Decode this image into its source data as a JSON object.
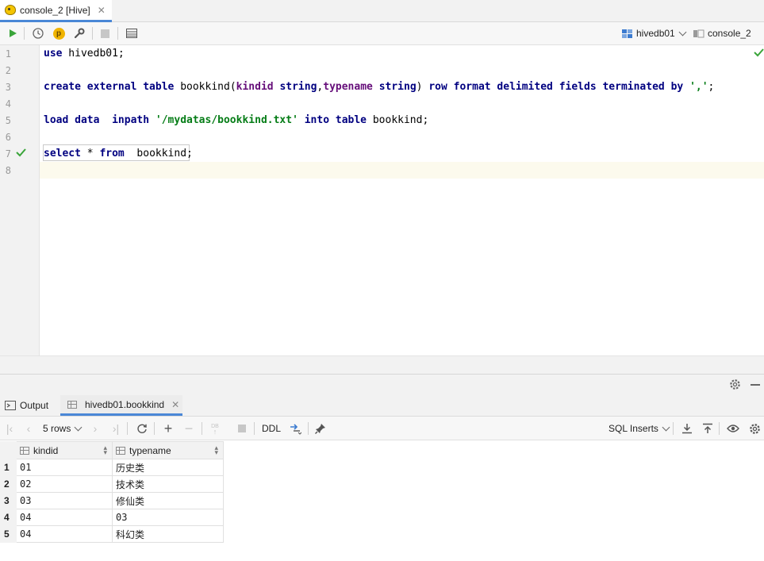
{
  "tab": {
    "title": "console_2 [Hive]",
    "close_icon": "close-icon"
  },
  "toolbar": {
    "datasource": "hivedb01",
    "session": "console_2",
    "p_badge": "p"
  },
  "editor": {
    "line_numbers": [
      "1",
      "2",
      "3",
      "4",
      "5",
      "6",
      "7",
      "8"
    ],
    "lines": {
      "l1": {
        "kw": "use",
        "rest": " hivedb01;"
      },
      "l3": {
        "kw1": "create external table",
        "name": " bookkind(",
        "c1": "kindid",
        "t1": " string",
        "comma": ",",
        "c2": "typename",
        "t2": " string",
        "p": ") ",
        "kw2": "row format delimited fields terminated by",
        "sp": " ",
        "s": "','",
        "end": ";"
      },
      "l5": {
        "kw1": "load data  inpath",
        "sp": " ",
        "s": "'/mydatas/bookkind.txt'",
        "sp2": " ",
        "kw2": "into table",
        "rest": " bookkind;"
      },
      "l7": {
        "kw1": "select",
        "star": " * ",
        "kw2": "from",
        "rest": "  bookkind;"
      }
    }
  },
  "results": {
    "tabs": {
      "output": "Output",
      "table": "hivedb01.bookkind"
    },
    "toolbar": {
      "rows": "5 rows",
      "ddl": "DDL",
      "db_badge": "DB",
      "export_format": "SQL Inserts"
    },
    "columns": [
      "kindid",
      "typename"
    ],
    "rows": [
      {
        "n": "1",
        "kindid": "01",
        "typename": "历史类"
      },
      {
        "n": "2",
        "kindid": "02",
        "typename": "技术类"
      },
      {
        "n": "3",
        "kindid": "03",
        "typename": "修仙类"
      },
      {
        "n": "4",
        "kindid": "04",
        "typename": "03"
      },
      {
        "n": "5",
        "kindid": "04",
        "typename": "科幻类"
      }
    ]
  },
  "colors": {
    "keyword": "#000080",
    "column": "#660e7a",
    "string": "#067d17",
    "run": "#3aa53a",
    "accent": "#4a87d6"
  }
}
